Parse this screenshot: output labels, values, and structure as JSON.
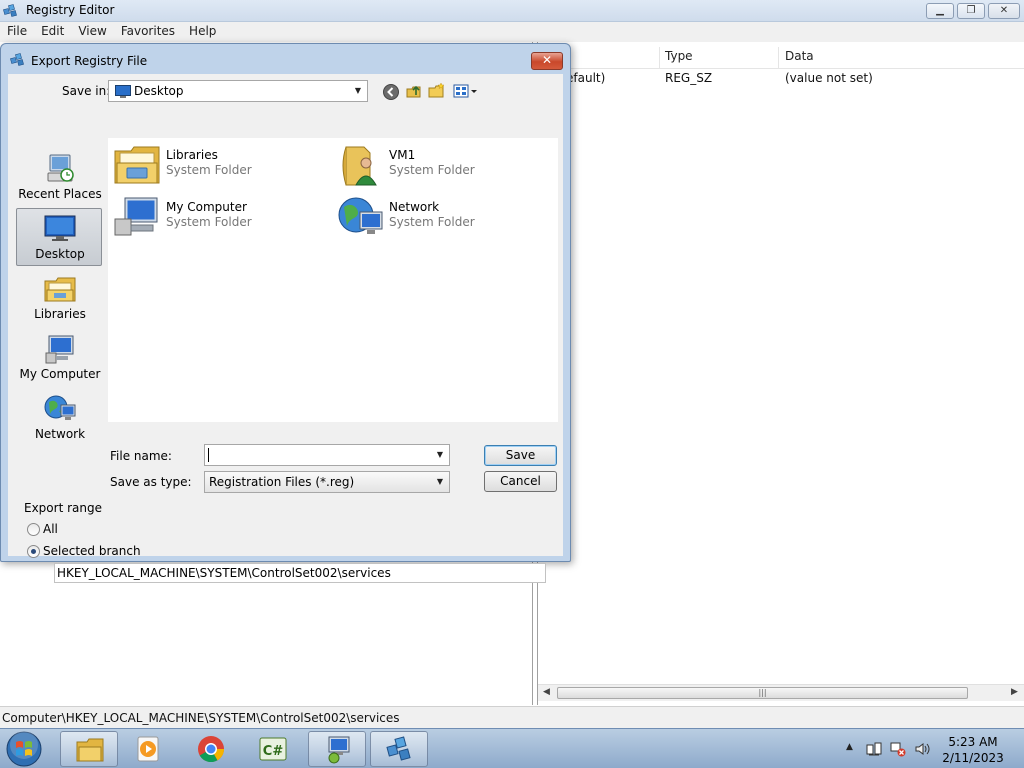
{
  "regedit": {
    "title": "Registry Editor",
    "menu": [
      "File",
      "Edit",
      "View",
      "Favorites",
      "Help"
    ],
    "list_headers": {
      "name": "e",
      "type": "Type",
      "data": "Data"
    },
    "rows": [
      {
        "name": "efault)",
        "type": "REG_SZ",
        "data": "(value not set)"
      }
    ],
    "status": "Computer\\HKEY_LOCAL_MACHINE\\SYSTEM\\ControlSet002\\services"
  },
  "dialog": {
    "title": "Export Registry File",
    "close_label": "✕",
    "save_in_label": "Save in:",
    "save_in_value": "Desktop",
    "places": [
      {
        "label": "Recent Places",
        "icon": "recent-places-icon"
      },
      {
        "label": "Desktop",
        "icon": "desktop-icon",
        "selected": true
      },
      {
        "label": "Libraries",
        "icon": "libraries-icon"
      },
      {
        "label": "My Computer",
        "icon": "computer-icon"
      },
      {
        "label": "Network",
        "icon": "network-icon"
      }
    ],
    "files": [
      {
        "name": "Libraries",
        "type": "System Folder",
        "icon": "libraries-folder-icon"
      },
      {
        "name": "VM1",
        "type": "System Folder",
        "icon": "user-folder-icon"
      },
      {
        "name": "My Computer",
        "type": "System Folder",
        "icon": "computer-icon"
      },
      {
        "name": "Network",
        "type": "System Folder",
        "icon": "network-globe-icon"
      }
    ],
    "file_name_label": "File name:",
    "file_name_value": "",
    "save_as_type_label": "Save as type:",
    "save_as_type_value": "Registration Files (*.reg)",
    "save_label": "Save",
    "cancel_label": "Cancel",
    "export_range_label": "Export range",
    "all_label": "All",
    "selected_branch_label": "Selected branch",
    "branch_value": "HKEY_LOCAL_MACHINE\\SYSTEM\\ControlSet002\\services"
  },
  "taskbar": {
    "time": "5:23 AM",
    "date": "2/11/2023",
    "apps": [
      "windows-explorer-icon",
      "media-player-icon",
      "chrome-icon",
      "csharp-icon",
      "remote-desktop-icon",
      "registry-editor-icon"
    ]
  }
}
